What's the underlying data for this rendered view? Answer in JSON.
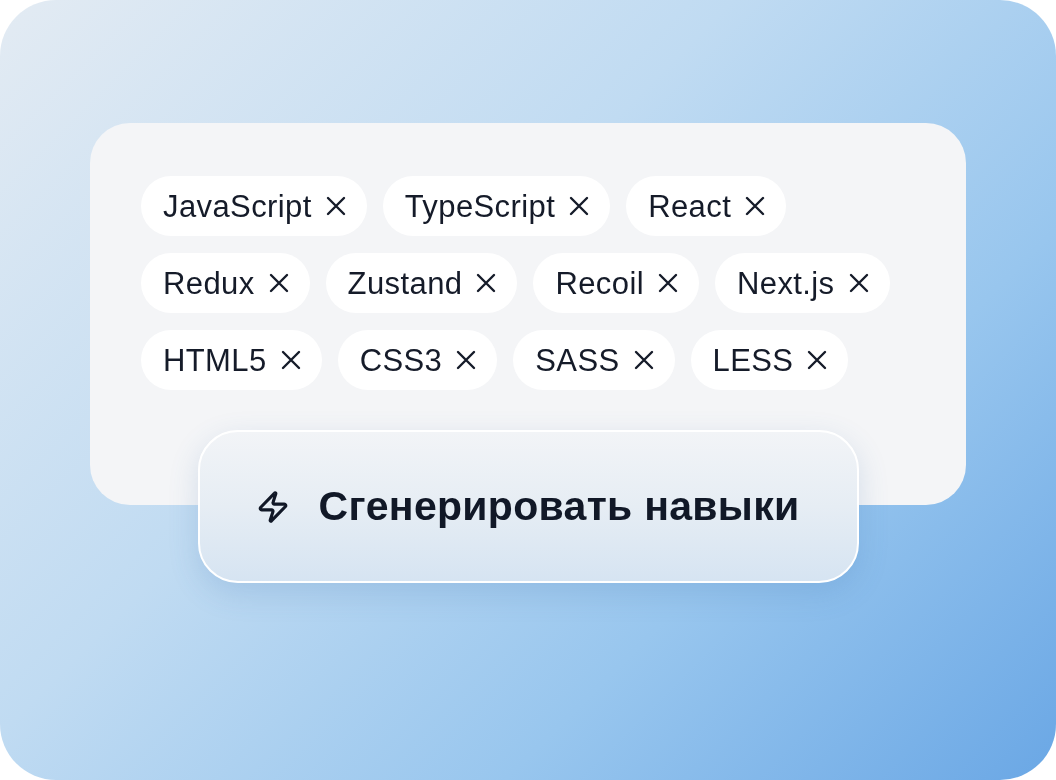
{
  "skills_card": {
    "tag_rows": [
      {
        "tags": [
          {
            "label": "JavaScript"
          },
          {
            "label": "TypeScript"
          },
          {
            "label": "React"
          }
        ]
      },
      {
        "tags": [
          {
            "label": "Redux"
          },
          {
            "label": "Zustand"
          },
          {
            "label": "Recoil"
          },
          {
            "label": "Next.js"
          }
        ]
      },
      {
        "tags": [
          {
            "label": "HTML5"
          },
          {
            "label": "CSS3"
          },
          {
            "label": "SASS"
          },
          {
            "label": "LESS"
          }
        ]
      }
    ]
  },
  "generate_button": {
    "label": "Сгенерировать навыки"
  }
}
